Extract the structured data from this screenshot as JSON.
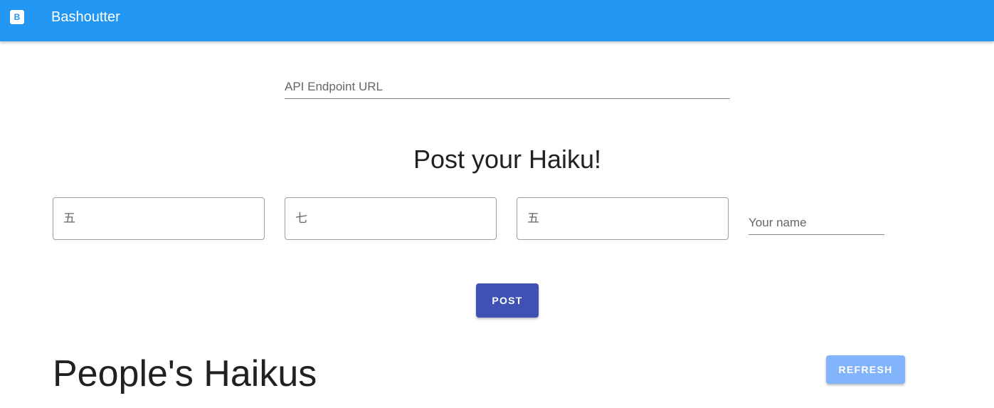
{
  "appbar": {
    "icon": "b-logo-icon",
    "icon_letter": "B",
    "title": "Bashoutter",
    "color": "#2196f3"
  },
  "api": {
    "placeholder": "API Endpoint URL",
    "value": ""
  },
  "post_section": {
    "title": "Post your Haiku!",
    "line1_placeholder": "五",
    "line2_placeholder": "七",
    "line3_placeholder": "五",
    "name_placeholder": "Your name",
    "post_label": "POST",
    "post_color": "#3f51b5"
  },
  "haikus_section": {
    "title": "People's Haikus",
    "refresh_label": "REFRESH",
    "refresh_color": "#82b4fb"
  }
}
